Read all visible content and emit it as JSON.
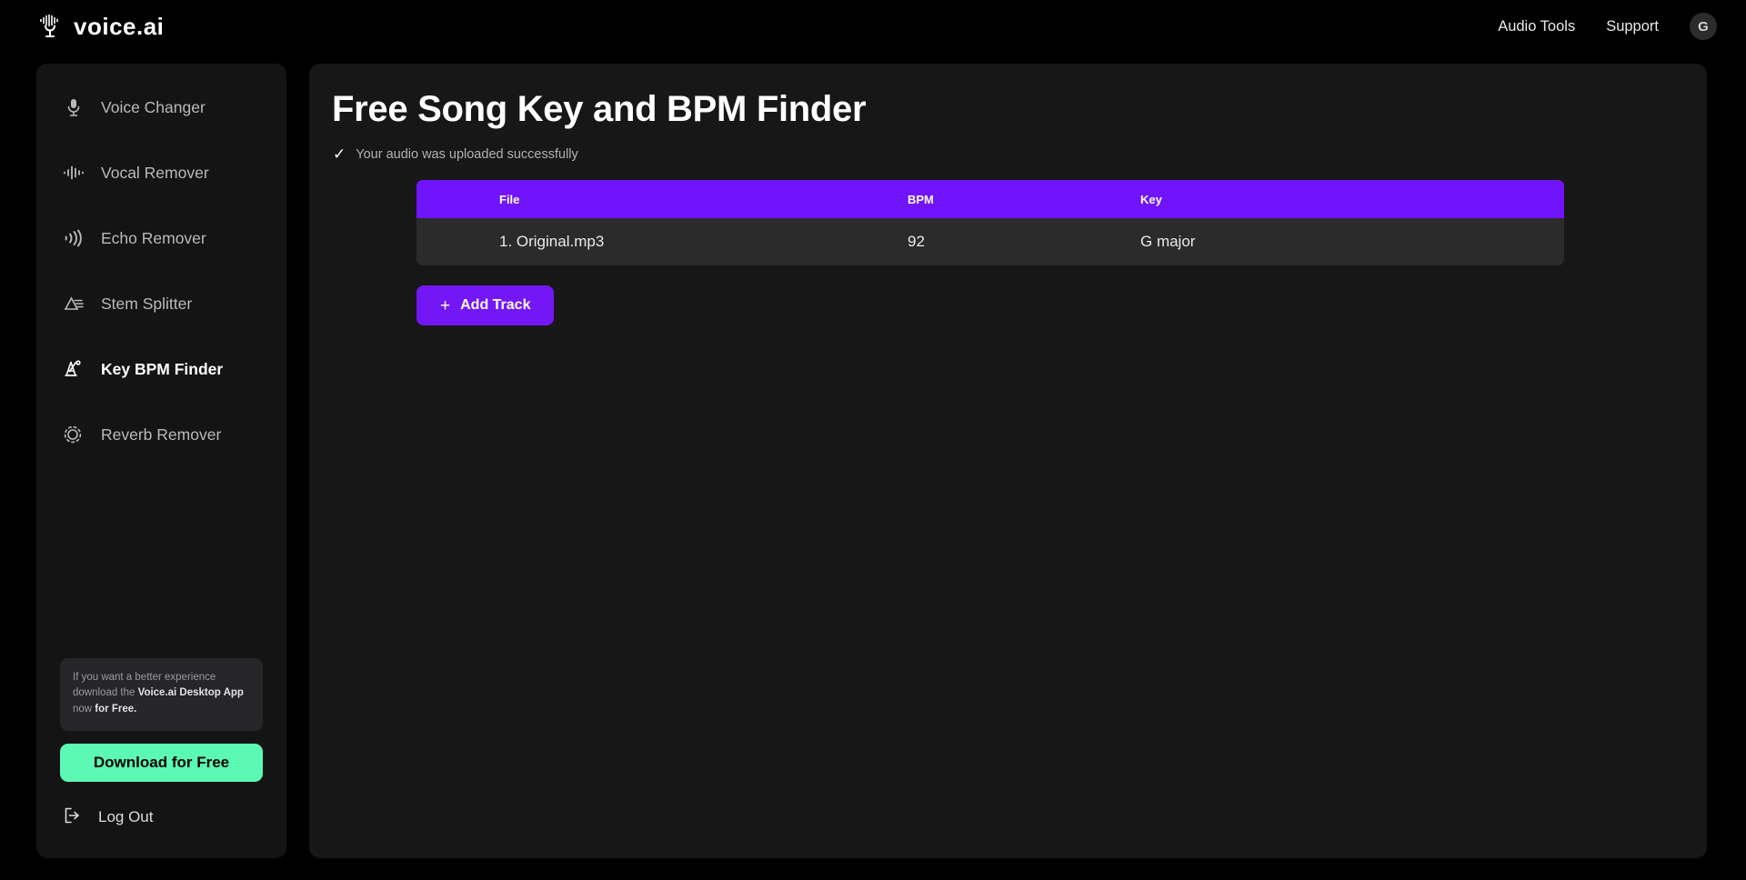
{
  "brand": {
    "name": "voice.ai",
    "logo_icon": "microphone-waveform-icon"
  },
  "topnav": {
    "links": [
      {
        "label": "Audio Tools"
      },
      {
        "label": "Support"
      }
    ],
    "avatar_initial": "G"
  },
  "sidebar": {
    "items": [
      {
        "label": "Voice Changer",
        "icon": "microphone-icon",
        "active": false
      },
      {
        "label": "Vocal Remover",
        "icon": "waveform-icon",
        "active": false
      },
      {
        "label": "Echo Remover",
        "icon": "echo-waves-icon",
        "active": false
      },
      {
        "label": "Stem Splitter",
        "icon": "prism-split-icon",
        "active": false
      },
      {
        "label": "Key BPM Finder",
        "icon": "metronome-icon",
        "active": true
      },
      {
        "label": "Reverb Remover",
        "icon": "reverb-ring-icon",
        "active": false
      }
    ],
    "promo": {
      "line1": "If you want a better experience",
      "line2_prefix": "download the ",
      "line2_bold": "Voice.ai Desktop App",
      "line3_prefix": "now ",
      "line3_bold": "for Free."
    },
    "download_label": "Download for Free",
    "logout_label": "Log Out",
    "logout_icon": "logout-arrow-icon"
  },
  "main": {
    "title": "Free Song Key and BPM Finder",
    "status_text": "Your audio was uploaded successfully",
    "status_icon": "check-icon",
    "table": {
      "headers": {
        "file": "File",
        "bpm": "BPM",
        "key": "Key"
      },
      "rows": [
        {
          "file": "1. Original.mp3",
          "bpm": "92",
          "key": "G major"
        }
      ]
    },
    "add_track_label": "Add Track",
    "add_track_icon": "plus-icon"
  },
  "colors": {
    "accent_purple": "#7014FC",
    "button_purple": "#7317F7",
    "accent_green": "#5CF9B4",
    "panel_bg": "#171717",
    "sidebar_bg": "#141414",
    "row_bg": "#2B2B2B"
  }
}
